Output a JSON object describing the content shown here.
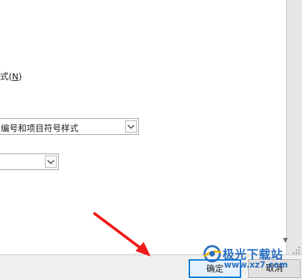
{
  "dialog": {
    "style_label": "式(",
    "style_mnemonic": "N",
    "style_label_close": ")",
    "list_style_select": {
      "value": "编号和项目符号样式"
    },
    "second_select": {
      "value": ""
    },
    "ok_button": "确定",
    "cancel_button": "取消"
  },
  "watermark": {
    "name": "极光下载站",
    "url": "www.xz7.com"
  },
  "colors": {
    "arrow": "#f01919",
    "focus_border": "#0078d7",
    "watermark_blue": "#2c6fc0"
  }
}
